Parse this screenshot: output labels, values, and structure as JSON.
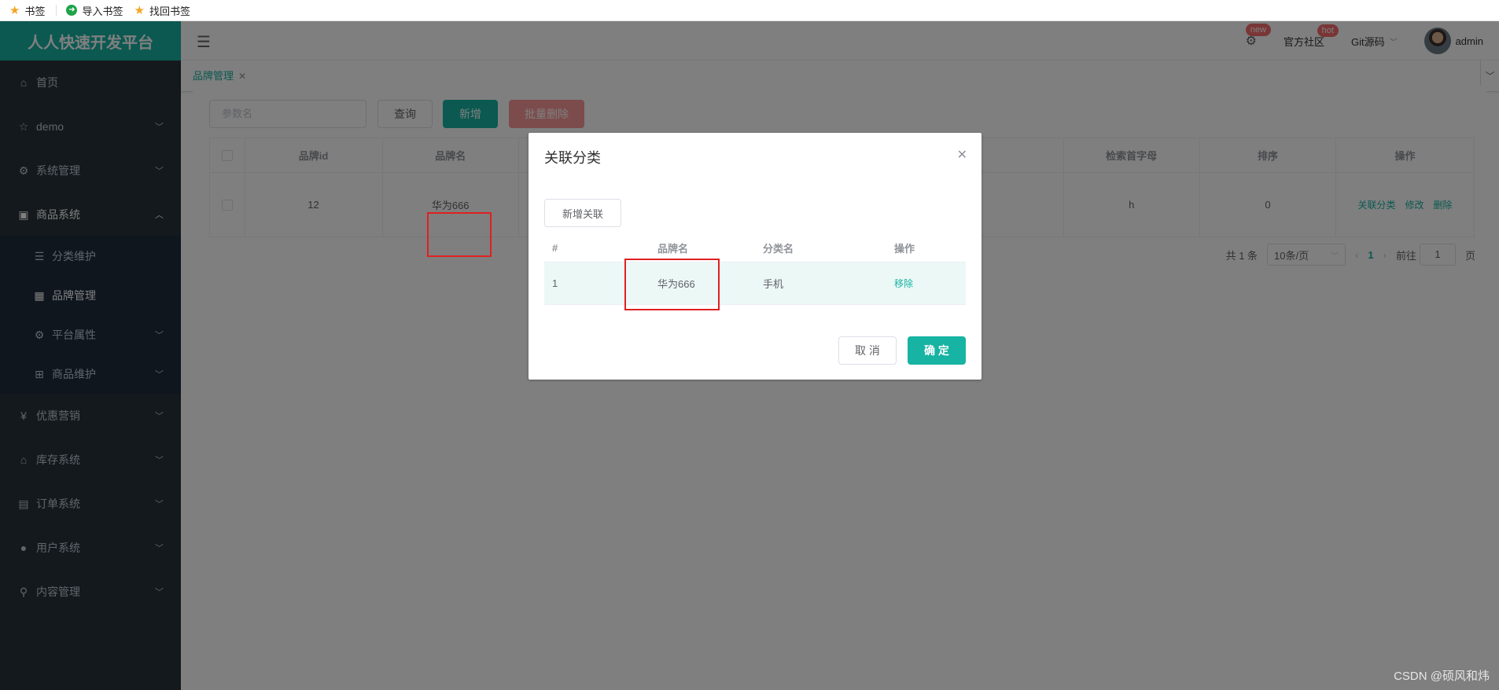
{
  "bookmarks": [
    {
      "icon": "star-icon",
      "label": "书签"
    },
    {
      "icon": "import-icon",
      "label": "导入书签"
    },
    {
      "icon": "star-icon",
      "label": "找回书签"
    }
  ],
  "brand": "人人快速开发平台",
  "sidebar": {
    "items": [
      {
        "icon": "home-icon",
        "label": "首页"
      },
      {
        "icon": "star-outline-icon",
        "label": "demo"
      },
      {
        "icon": "gear-icon",
        "label": "系统管理"
      },
      {
        "icon": "product-icon",
        "label": "商品系统"
      },
      {
        "icon": "list-icon",
        "label": "分类维护"
      },
      {
        "icon": "image-icon",
        "label": "品牌管理"
      },
      {
        "icon": "gear-icon",
        "label": "平台属性"
      },
      {
        "icon": "grid-icon",
        "label": "商品维护"
      },
      {
        "icon": "coupon-icon",
        "label": "优惠营销"
      },
      {
        "icon": "warehouse-icon",
        "label": "库存系统"
      },
      {
        "icon": "order-icon",
        "label": "订单系统"
      },
      {
        "icon": "user-icon",
        "label": "用户系统"
      },
      {
        "icon": "search-icon",
        "label": "内容管理"
      }
    ]
  },
  "topbar": {
    "settings_badge": "new",
    "community": "官方社区",
    "community_badge": "hot",
    "git": "Git源码",
    "user": "admin"
  },
  "tabs": [
    {
      "label": "品牌管理"
    }
  ],
  "toolbar": {
    "search_placeholder": "参数名",
    "query_label": "查询",
    "add_label": "新增",
    "batch_delete_label": "批量删除"
  },
  "table": {
    "headers": [
      "品牌id",
      "品牌名",
      "检索首字母",
      "排序",
      "操作"
    ],
    "rows": [
      {
        "id": "12",
        "name": "华为666",
        "first_letter": "h",
        "sort": "0"
      }
    ],
    "actions": [
      "关联分类",
      "修改",
      "删除"
    ]
  },
  "pagination": {
    "total": "共 1 条",
    "page_size": "10条/页",
    "current": "1",
    "goto_prefix": "前往",
    "goto_value": "1",
    "goto_suffix": "页"
  },
  "dialog": {
    "title": "关联分类",
    "add_button": "新增关联",
    "headers": [
      "#",
      "品牌名",
      "分类名",
      "操作"
    ],
    "rows": [
      {
        "index": "1",
        "brand": "华为666",
        "category": "手机",
        "action": "移除"
      }
    ],
    "cancel": "取 消",
    "confirm": "确 定"
  },
  "watermark": "CSDN @硕风和炜",
  "colors": {
    "accent": "#17b3a3",
    "sidebar": "#263238",
    "danger": "#f56c6c",
    "highlight": "#e02020"
  }
}
